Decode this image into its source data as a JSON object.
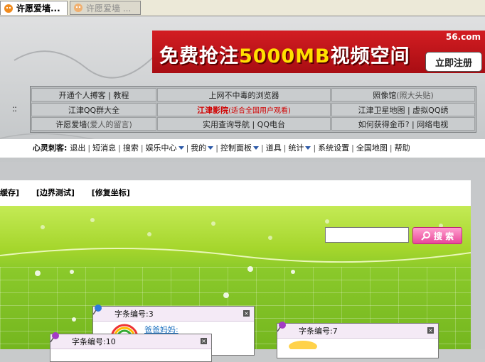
{
  "tabs": [
    {
      "label": "许愿爱墙...",
      "active": true
    },
    {
      "label": "许愿爱墙 ...",
      "active": false
    }
  ],
  "banner": {
    "logo": "56.com",
    "text_before": "免费抢注",
    "number": "5000MB",
    "text_after": "视频空间",
    "button": "立即注册"
  },
  "links": {
    "r1c1": "开通个人搏客 | 教程",
    "r1c2": "上网不中毒的浏览器",
    "r1c3": "照像馆",
    "r1c3_note": "(照大头贴)",
    "r2c1": "江津QQ群大全",
    "r2c2": "江津影院",
    "r2c2_note": "(适合全国用户观看)",
    "r2c3": "江津卫星地图 | 虚拟QQ绣",
    "r3c1": "许愿爱墙",
    "r3c1_note": "(爱人的留言)",
    "r3c2": "实用查询导航 | QQ电台",
    "r3c3": "如何获得金币? | 网络电视"
  },
  "nav": {
    "user_label": "心灵刺客:",
    "items": [
      "退出",
      "短消息",
      "搜索",
      "娱乐中心",
      "我的",
      "控制面板",
      "道具",
      "统计",
      "系统设置",
      "全国地图",
      "帮助"
    ]
  },
  "tools": [
    "缓存]",
    "[边界测试]",
    "[修复坐标]"
  ],
  "search": {
    "button": "搜 索",
    "value": ""
  },
  "notes": [
    {
      "label": "字条编号:",
      "number": "3",
      "author": "爸爸妈妈:"
    },
    {
      "label": "字条编号:",
      "number": "10"
    },
    {
      "label": "字条编号:",
      "number": "7"
    }
  ],
  "colors": {
    "banner_red": "#c4151b",
    "link_red": "#d00000",
    "wall_green": "#9ed12f",
    "search_pink": "#e8479a"
  }
}
